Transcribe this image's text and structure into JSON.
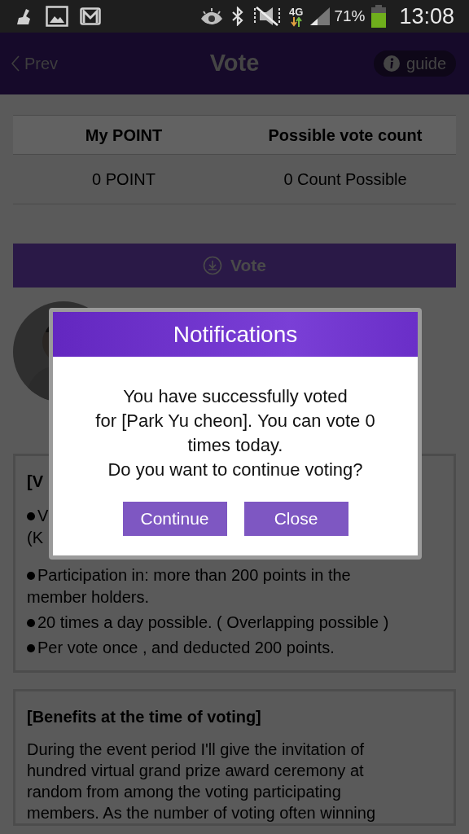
{
  "status_bar": {
    "network": "4G",
    "battery": "71%",
    "time": "13:08"
  },
  "header": {
    "back": "Prev",
    "title": "Vote",
    "guide": "guide"
  },
  "points_table": {
    "columns": [
      "My POINT",
      "Possible vote count"
    ],
    "values": [
      "0 POINT",
      "0 Count Possible"
    ]
  },
  "vote_button": "Vote",
  "info_card": {
    "title": "[V",
    "bullets": [
      {
        "lines": [
          "V",
          "(K"
        ]
      },
      {
        "lines": [
          "Participation in: more than 200 points in the",
          "member holders."
        ]
      },
      {
        "lines": [
          "20 times a day possible. ( Overlapping possible )"
        ]
      },
      {
        "lines": [
          "Per vote once , and deducted 200 points."
        ]
      }
    ]
  },
  "benefits_card": {
    "title": "[Benefits at the time of voting]",
    "text": "During the event period I'll give the invitation of hundred virtual grand prize award ceremony at random from among the voting participating members. As the number of voting often winning"
  },
  "dialog": {
    "title": "Notifications",
    "message": [
      "You have successfully voted",
      "for [Park Yu cheon]. You can vote 0",
      "times today.",
      "Do you want to continue voting?"
    ],
    "buttons": [
      {
        "label": "Continue"
      },
      {
        "label": "Close"
      }
    ]
  }
}
